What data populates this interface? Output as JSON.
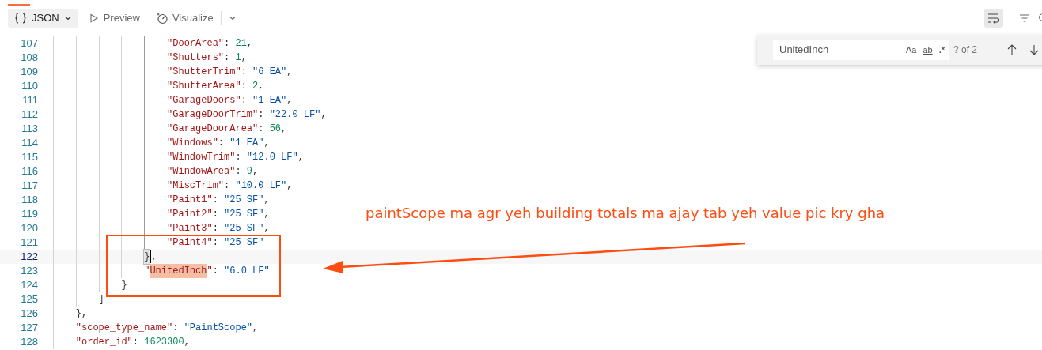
{
  "toolbar": {
    "format_button": {
      "label": "JSON",
      "selected": true
    },
    "preview_button": {
      "label": "Preview"
    },
    "visualize_button": {
      "label": "Visualize"
    },
    "wrap_button": {
      "selected": true
    }
  },
  "find_widget": {
    "value": "UnitedInch",
    "options": [
      "Aa",
      "ab",
      ".*"
    ],
    "count": "? of 2"
  },
  "lines": [
    {
      "number": "107",
      "current": false,
      "tokens": [
        {
          "kind": "key",
          "text": "                    \"DoorArea\""
        },
        {
          "kind": "punct",
          "text": ": "
        },
        {
          "kind": "num",
          "text": "21"
        },
        {
          "kind": "punct",
          "text": ","
        }
      ]
    },
    {
      "number": "108",
      "current": false,
      "tokens": [
        {
          "kind": "key",
          "text": "                    \"Shutters\""
        },
        {
          "kind": "punct",
          "text": ": "
        },
        {
          "kind": "num",
          "text": "1"
        },
        {
          "kind": "punct",
          "text": ","
        }
      ]
    },
    {
      "number": "109",
      "current": false,
      "tokens": [
        {
          "kind": "key",
          "text": "                    \"ShutterTrim\""
        },
        {
          "kind": "punct",
          "text": ": "
        },
        {
          "kind": "str",
          "text": "\"6 EA\""
        },
        {
          "kind": "punct",
          "text": ","
        }
      ]
    },
    {
      "number": "110",
      "current": false,
      "tokens": [
        {
          "kind": "key",
          "text": "                    \"ShutterArea\""
        },
        {
          "kind": "punct",
          "text": ": "
        },
        {
          "kind": "num",
          "text": "2"
        },
        {
          "kind": "punct",
          "text": ","
        }
      ]
    },
    {
      "number": "111",
      "current": false,
      "tokens": [
        {
          "kind": "key",
          "text": "                    \"GarageDoors\""
        },
        {
          "kind": "punct",
          "text": ": "
        },
        {
          "kind": "str",
          "text": "\"1 EA\""
        },
        {
          "kind": "punct",
          "text": ","
        }
      ]
    },
    {
      "number": "112",
      "current": false,
      "tokens": [
        {
          "kind": "key",
          "text": "                    \"GarageDoorTrim\""
        },
        {
          "kind": "punct",
          "text": ": "
        },
        {
          "kind": "str",
          "text": "\"22.0 LF\""
        },
        {
          "kind": "punct",
          "text": ","
        }
      ]
    },
    {
      "number": "113",
      "current": false,
      "tokens": [
        {
          "kind": "key",
          "text": "                    \"GarageDoorArea\""
        },
        {
          "kind": "punct",
          "text": ": "
        },
        {
          "kind": "num",
          "text": "56"
        },
        {
          "kind": "punct",
          "text": ","
        }
      ]
    },
    {
      "number": "114",
      "current": false,
      "tokens": [
        {
          "kind": "key",
          "text": "                    \"Windows\""
        },
        {
          "kind": "punct",
          "text": ": "
        },
        {
          "kind": "str",
          "text": "\"1 EA\""
        },
        {
          "kind": "punct",
          "text": ","
        }
      ]
    },
    {
      "number": "115",
      "current": false,
      "tokens": [
        {
          "kind": "key",
          "text": "                    \"WindowTrim\""
        },
        {
          "kind": "punct",
          "text": ": "
        },
        {
          "kind": "str",
          "text": "\"12.0 LF\""
        },
        {
          "kind": "punct",
          "text": ","
        }
      ]
    },
    {
      "number": "116",
      "current": false,
      "tokens": [
        {
          "kind": "key",
          "text": "                    \"WindowArea\""
        },
        {
          "kind": "punct",
          "text": ": "
        },
        {
          "kind": "num",
          "text": "9"
        },
        {
          "kind": "punct",
          "text": ","
        }
      ]
    },
    {
      "number": "117",
      "current": false,
      "tokens": [
        {
          "kind": "key",
          "text": "                    \"MiscTrim\""
        },
        {
          "kind": "punct",
          "text": ": "
        },
        {
          "kind": "str",
          "text": "\"10.0 LF\""
        },
        {
          "kind": "punct",
          "text": ","
        }
      ]
    },
    {
      "number": "118",
      "current": false,
      "tokens": [
        {
          "kind": "key",
          "text": "                    \"Paint1\""
        },
        {
          "kind": "punct",
          "text": ": "
        },
        {
          "kind": "str",
          "text": "\"25 SF\""
        },
        {
          "kind": "punct",
          "text": ","
        }
      ]
    },
    {
      "number": "119",
      "current": false,
      "tokens": [
        {
          "kind": "key",
          "text": "                    \"Paint2\""
        },
        {
          "kind": "punct",
          "text": ": "
        },
        {
          "kind": "str",
          "text": "\"25 SF\""
        },
        {
          "kind": "punct",
          "text": ","
        }
      ]
    },
    {
      "number": "120",
      "current": false,
      "tokens": [
        {
          "kind": "key",
          "text": "                    \"Paint3\""
        },
        {
          "kind": "punct",
          "text": ": "
        },
        {
          "kind": "str",
          "text": "\"25 SF\""
        },
        {
          "kind": "punct",
          "text": ","
        }
      ]
    },
    {
      "number": "121",
      "current": false,
      "tokens": [
        {
          "kind": "key",
          "text": "                    \"Paint4\""
        },
        {
          "kind": "punct",
          "text": ": "
        },
        {
          "kind": "str",
          "text": "\"25 SF\""
        }
      ]
    },
    {
      "number": "122",
      "current": true,
      "tokens": [
        {
          "kind": "bracket",
          "text": "                }"
        },
        {
          "kind": "punct",
          "text": ","
        }
      ]
    },
    {
      "number": "123",
      "current": false,
      "tokens": [
        {
          "kind": "key",
          "text": "                \""
        },
        {
          "kind": "match",
          "text": "UnitedInch"
        },
        {
          "kind": "key",
          "text": "\""
        },
        {
          "kind": "punct",
          "text": ": "
        },
        {
          "kind": "str",
          "text": "\"6.0 LF\""
        }
      ]
    },
    {
      "number": "124",
      "current": false,
      "tokens": [
        {
          "kind": "punct",
          "text": "            }"
        }
      ]
    },
    {
      "number": "125",
      "current": false,
      "tokens": [
        {
          "kind": "punct",
          "text": "        ]"
        }
      ]
    },
    {
      "number": "126",
      "current": false,
      "tokens": [
        {
          "kind": "punct",
          "text": "    },"
        }
      ]
    },
    {
      "number": "127",
      "current": false,
      "tokens": [
        {
          "kind": "key",
          "text": "    \"scope_type_name\""
        },
        {
          "kind": "punct",
          "text": ": "
        },
        {
          "kind": "str",
          "text": "\"PaintScope\""
        },
        {
          "kind": "punct",
          "text": ","
        }
      ]
    },
    {
      "number": "128",
      "current": false,
      "tokens": [
        {
          "kind": "key",
          "text": "    \"order_id\""
        },
        {
          "kind": "punct",
          "text": ": "
        },
        {
          "kind": "num",
          "text": "1623300"
        },
        {
          "kind": "punct",
          "text": ","
        }
      ]
    }
  ],
  "annotation": {
    "text": "paintScope ma agr yeh building totals ma ajay tab yeh value pic kry gha"
  }
}
